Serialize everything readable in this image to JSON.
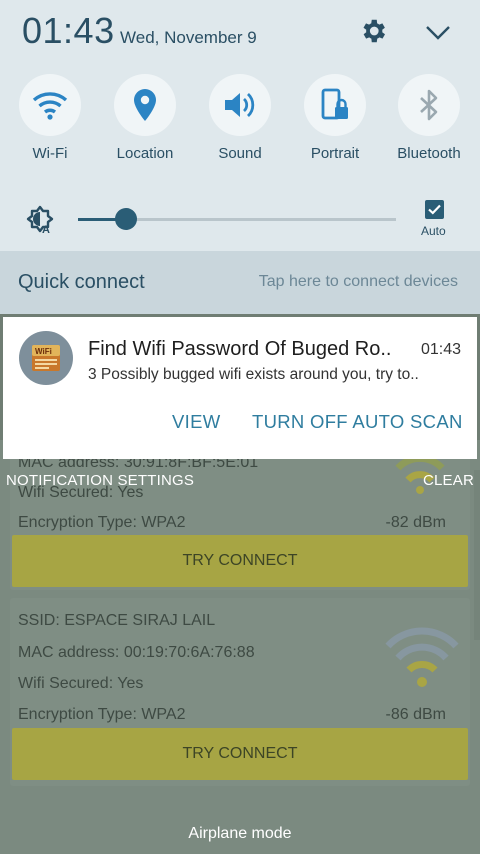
{
  "status": {
    "time": "01:43",
    "date": "Wed, November 9"
  },
  "icons": {
    "settings": "gear-icon",
    "expand": "chevron-down-icon"
  },
  "quick_settings": [
    {
      "label": "Wi-Fi",
      "icon": "wifi-icon",
      "active": true
    },
    {
      "label": "Location",
      "icon": "location-pin-icon",
      "active": true
    },
    {
      "label": "Sound",
      "icon": "speaker-icon",
      "active": true
    },
    {
      "label": "Portrait",
      "icon": "rotation-lock-icon",
      "active": true
    },
    {
      "label": "Bluetooth",
      "icon": "bluetooth-icon",
      "active": false
    }
  ],
  "brightness": {
    "level": 0.15,
    "auto_checked": true,
    "auto_label": "Auto"
  },
  "quick_connect": {
    "title": "Quick connect",
    "hint": "Tap here to connect devices"
  },
  "notification": {
    "title": "Find Wifi Password Of Buged Ro..",
    "time": "01:43",
    "body": "3 Possibly bugged wifi exists around you, try to..",
    "actions": [
      "VIEW",
      "TURN OFF AUTO SCAN"
    ]
  },
  "shade_footer": {
    "settings": "NOTIFICATION SETTINGS",
    "clear": "CLEAR"
  },
  "background_app": {
    "card1": {
      "mac": "MAC address: 30:91:8F:BF:5E:01",
      "secured": "Wifi Secured: Yes",
      "encryption": "Encryption Type: WPA2",
      "signal": "-82 dBm",
      "button": "TRY CONNECT"
    },
    "card2": {
      "ssid": "SSID: ESPACE SIRAJ LAIL",
      "mac": "MAC address: 00:19:70:6A:76:88",
      "secured": "Wifi Secured: Yes",
      "encryption": "Encryption Type: WPA2",
      "signal": "-86 dBm",
      "button": "TRY CONNECT"
    },
    "airplane_mode": "Airplane mode"
  },
  "colors": {
    "accent": "#2a5d76",
    "action": "#2f7d9f",
    "button_bg": "#a7a544"
  }
}
